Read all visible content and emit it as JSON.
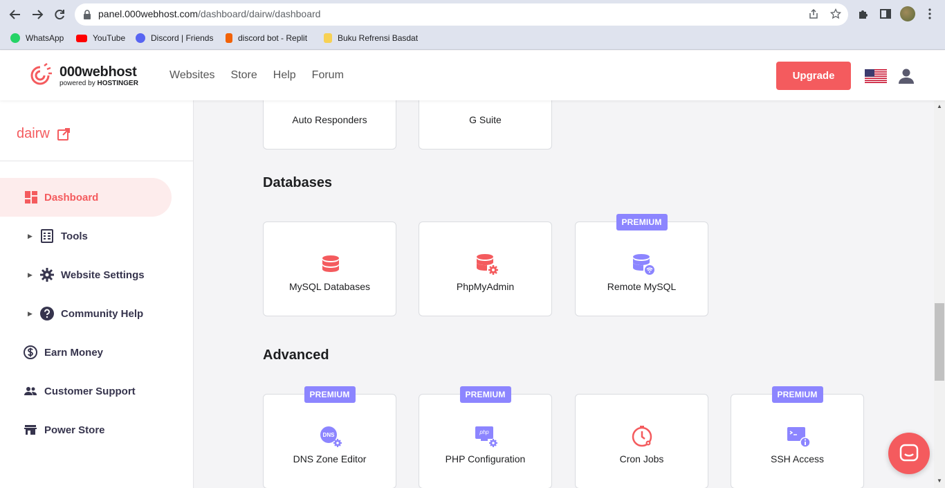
{
  "browser": {
    "url_host": "panel.000webhost.com",
    "url_path": "/dashboard/dairw/dashboard",
    "bookmarks": [
      {
        "label": "WhatsApp",
        "color": "#25d366"
      },
      {
        "label": "YouTube",
        "color": "#ff0000"
      },
      {
        "label": "Discord | Friends",
        "color": "#5865f2"
      },
      {
        "label": "discord bot - Replit",
        "color": "#f26207"
      },
      {
        "label": "Buku Refrensi Basdat",
        "color": "#f7d154"
      }
    ]
  },
  "header": {
    "logo_name": "000webhost",
    "logo_sub_prefix": "powered by ",
    "logo_sub_brand": "HOSTINGER",
    "nav": [
      "Websites",
      "Store",
      "Help",
      "Forum"
    ],
    "upgrade_label": "Upgrade",
    "accent": "#f45b5e"
  },
  "sidebar": {
    "site_name": "dairw",
    "items": [
      {
        "label": "Dashboard",
        "icon": "dashboard-icon",
        "active": true
      },
      {
        "label": "Tools",
        "icon": "tools-icon",
        "expandable": true
      },
      {
        "label": "Website Settings",
        "icon": "gear-icon",
        "expandable": true
      },
      {
        "label": "Community Help",
        "icon": "help-icon",
        "expandable": true
      },
      {
        "label": "Earn Money",
        "icon": "dollar-icon"
      },
      {
        "label": "Customer Support",
        "icon": "people-icon"
      },
      {
        "label": "Power Store",
        "icon": "store-icon"
      }
    ]
  },
  "main": {
    "top_cards": [
      {
        "label": "Auto Responders"
      },
      {
        "label": "G Suite"
      }
    ],
    "databases": {
      "title": "Databases",
      "cards": [
        {
          "label": "MySQL Databases",
          "icon": "database-icon"
        },
        {
          "label": "PhpMyAdmin",
          "icon": "database-gear-icon"
        },
        {
          "label": "Remote MySQL",
          "icon": "database-remote-icon",
          "badge": "PREMIUM"
        }
      ]
    },
    "advanced": {
      "title": "Advanced",
      "cards": [
        {
          "label": "DNS Zone Editor",
          "icon": "dns-icon",
          "badge": "PREMIUM"
        },
        {
          "label": "PHP Configuration",
          "icon": "php-icon",
          "badge": "PREMIUM"
        },
        {
          "label": "Cron Jobs",
          "icon": "clock-icon"
        },
        {
          "label": "SSH Access",
          "icon": "terminal-icon",
          "badge": "PREMIUM"
        }
      ]
    },
    "premium_color": "#8c85ff"
  }
}
